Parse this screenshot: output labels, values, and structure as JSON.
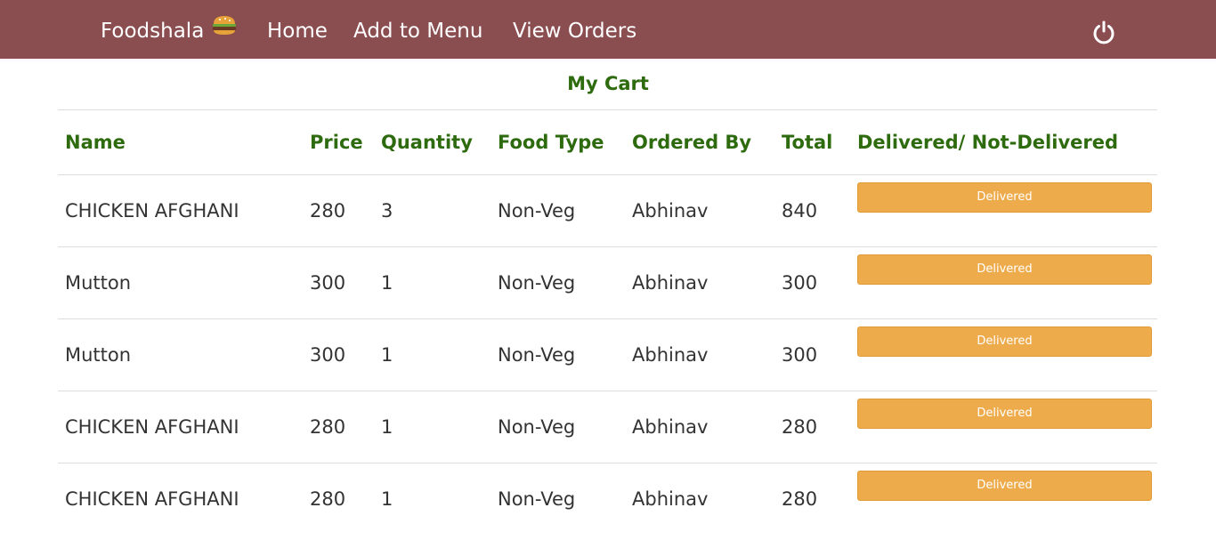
{
  "navbar": {
    "brand": "Foodshala",
    "brand_icon": "burger-icon",
    "links": [
      "Home",
      "Add to Menu",
      "View Orders"
    ],
    "power_icon": "power-icon",
    "background": "#8a4d50"
  },
  "page": {
    "title": "My Cart"
  },
  "table": {
    "headers": [
      "Name",
      "Price",
      "Quantity",
      "Food Type",
      "Ordered By",
      "Total",
      "Delivered/ Not-Delivered"
    ],
    "rows": [
      {
        "name": "CHICKEN AFGHANI",
        "price": "280",
        "quantity": "3",
        "food_type": "Non-Veg",
        "ordered_by": "Abhinav",
        "total": "840",
        "status": "Delivered"
      },
      {
        "name": "Mutton",
        "price": "300",
        "quantity": "1",
        "food_type": "Non-Veg",
        "ordered_by": "Abhinav",
        "total": "300",
        "status": "Delivered"
      },
      {
        "name": "Mutton",
        "price": "300",
        "quantity": "1",
        "food_type": "Non-Veg",
        "ordered_by": "Abhinav",
        "total": "300",
        "status": "Delivered"
      },
      {
        "name": "CHICKEN AFGHANI",
        "price": "280",
        "quantity": "1",
        "food_type": "Non-Veg",
        "ordered_by": "Abhinav",
        "total": "280",
        "status": "Delivered"
      },
      {
        "name": "CHICKEN AFGHANI",
        "price": "280",
        "quantity": "1",
        "food_type": "Non-Veg",
        "ordered_by": "Abhinav",
        "total": "280",
        "status": "Delivered"
      }
    ]
  },
  "colors": {
    "header_text": "#2e6b0f",
    "button": "#eeab4b"
  }
}
